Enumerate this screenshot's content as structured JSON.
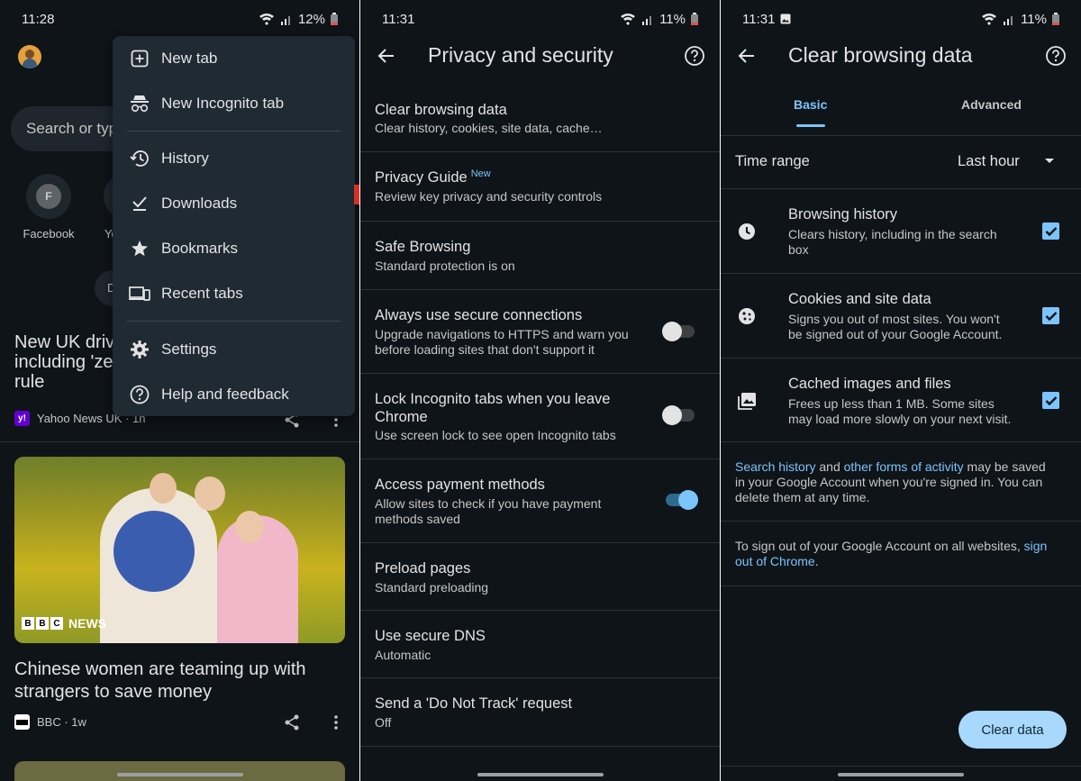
{
  "panel1": {
    "status": {
      "time": "11:28",
      "battery": "12%"
    },
    "search_placeholder": "Search or typ",
    "tiles": [
      {
        "letter": "F",
        "label": "Facebook"
      },
      {
        "label": "Yo"
      }
    ],
    "chip_text": "D",
    "article1": {
      "title_l1": "New UK driv",
      "title_l2": "including 'ze",
      "title_l3": "rule",
      "source": "Yahoo News UK · 1h",
      "source_icon": "y!"
    },
    "article2": {
      "title_l1": "Chinese women are teaming up with",
      "title_l2": "strangers to save money",
      "source": "BBC · 1w",
      "image_badge": "NEWS",
      "bbc_letters": [
        "B",
        "B",
        "C"
      ]
    },
    "menu": [
      {
        "label": "New tab",
        "icon": "plus-box-icon"
      },
      {
        "label": "New Incognito tab",
        "icon": "incognito-icon"
      },
      {
        "label": "History",
        "icon": "history-icon"
      },
      {
        "label": "Downloads",
        "icon": "download-check-icon"
      },
      {
        "label": "Bookmarks",
        "icon": "star-icon"
      },
      {
        "label": "Recent tabs",
        "icon": "devices-icon"
      },
      {
        "label": "Settings",
        "icon": "gear-icon"
      },
      {
        "label": "Help and feedback",
        "icon": "help-circle-icon"
      }
    ]
  },
  "panel2": {
    "status": {
      "time": "11:31",
      "battery": "11%"
    },
    "title": "Privacy and security",
    "rows": [
      {
        "title": "Clear browsing data",
        "sub1": "Clear history, cookies, site data, cache…"
      },
      {
        "title": "Privacy Guide",
        "badge": "New",
        "sub1": "Review key privacy and security controls"
      },
      {
        "title": "Safe Browsing",
        "sub1": "Standard protection is on"
      },
      {
        "title": "Always use secure connections",
        "sub1": "Upgrade navigations to HTTPS and warn you",
        "sub2": "before loading sites that don't support it",
        "toggle": false
      },
      {
        "title": "Lock Incognito tabs when you leave",
        "title2": "Chrome",
        "sub1": "Use screen lock to see open Incognito tabs",
        "toggle": false
      },
      {
        "title": "Access payment methods",
        "sub1": "Allow sites to check if you have payment",
        "sub2": "methods saved",
        "toggle": true
      },
      {
        "title": "Preload pages",
        "sub1": "Standard preloading"
      },
      {
        "title": "Use secure DNS",
        "sub1": "Automatic"
      },
      {
        "title": "Send a 'Do Not Track' request",
        "sub1": "Off"
      }
    ]
  },
  "panel3": {
    "status": {
      "time": "11:31",
      "battery": "11%"
    },
    "title": "Clear browsing data",
    "tabs": [
      "Basic",
      "Advanced"
    ],
    "time_range_label": "Time range",
    "time_range_value": "Last hour",
    "items": [
      {
        "title": "Browsing history",
        "sub1": "Clears history, including in the search",
        "sub2": "box",
        "checked": true
      },
      {
        "title": "Cookies and site data",
        "sub1": "Signs you out of most sites. You won't",
        "sub2": "be signed out of your Google Account.",
        "checked": true
      },
      {
        "title": "Cached images and files",
        "sub1": "Frees up less than 1 MB. Some sites",
        "sub2": "may load more slowly on your next visit.",
        "checked": true
      }
    ],
    "info1": {
      "link1": "Search history",
      "and": " and ",
      "link2": "other forms of activity",
      "rest1": " may be saved",
      "line2": "in your Google Account when you're signed in. You can",
      "line3": "delete them at any time."
    },
    "info2": {
      "text": "To sign out of your Google Account on all websites, ",
      "link1": "sign",
      "link2": "out of Chrome",
      "end": "."
    },
    "clear_button": "Clear data"
  },
  "colors": {
    "background": "#0f1419",
    "accent": "#7cc4fa",
    "menu_bg": "#1f2a33"
  }
}
